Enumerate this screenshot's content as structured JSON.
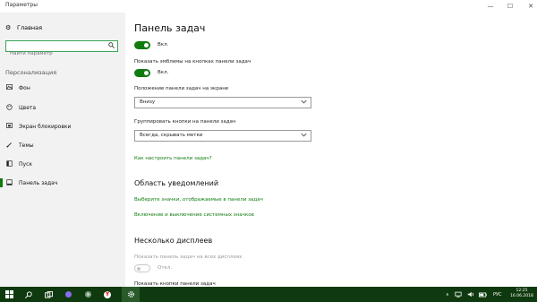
{
  "window": {
    "title": "Параметры",
    "minimize_glyph": "—",
    "maximize_glyph": "☐",
    "close_glyph": "✕"
  },
  "sidebar": {
    "home_icon": "gear-icon",
    "home_label": "Главная",
    "search_placeholder": "Найти параметр",
    "search_icon": "search-icon",
    "section_label": "Персонализация",
    "items": [
      {
        "label": "Фон",
        "icon": "image-icon",
        "active": false
      },
      {
        "label": "Цвета",
        "icon": "palette-icon",
        "active": false
      },
      {
        "label": "Экран блокировки",
        "icon": "lock-screen-icon",
        "active": false
      },
      {
        "label": "Темы",
        "icon": "brush-icon",
        "active": false
      },
      {
        "label": "Пуск",
        "icon": "start-icon",
        "active": false
      },
      {
        "label": "Панель задач",
        "icon": "taskbar-icon",
        "active": true
      }
    ]
  },
  "main": {
    "title": "Панель задач",
    "toggle1": {
      "state": "Вкл.",
      "on": true
    },
    "badges_label": "Показать эмблемы на кнопках панели задач",
    "toggle2": {
      "state": "Вкл.",
      "on": true
    },
    "position_label": "Положение панели задач на экране",
    "position_value": "Внизу",
    "group_label": "Группировать кнопки на панели задач",
    "group_value": "Всегда, скрывать метки",
    "customize_link": "Как настроить панели задач?",
    "notifications_heading": "Область уведомлений",
    "notif_link1": "Выберите значки, отображаемые в панели задач",
    "notif_link2": "Включение и выключение системных значков",
    "displays_heading": "Несколько дисплеев",
    "all_displays_label": "Показать панель задач на всех дисплеях",
    "toggle3": {
      "state": "Откл.",
      "on": false
    },
    "show_buttons_label": "Показать кнопки панели задач"
  },
  "taskbar": {
    "colors": {
      "background": "#0f3a0f",
      "accent": "#107c10"
    },
    "items": [
      {
        "name": "windows-start-icon"
      },
      {
        "name": "search-icon"
      },
      {
        "name": "task-view-icon"
      },
      {
        "name": "cortana-icon"
      },
      {
        "name": "app-icon"
      },
      {
        "name": "yandex-browser-icon"
      },
      {
        "name": "settings-icon",
        "active": true
      }
    ],
    "tray_chevron": "∧",
    "language": "РУС",
    "time": "12:25",
    "date": "16.06.2018"
  }
}
